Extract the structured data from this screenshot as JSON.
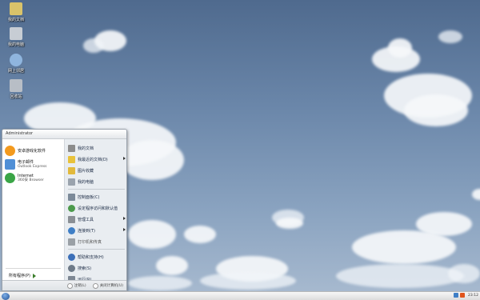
{
  "desktop": {
    "icons": [
      {
        "label": "我的文档",
        "icon": "my-documents-icon",
        "color": "#d9c36a"
      },
      {
        "label": "我的电脑",
        "icon": "my-computer-icon",
        "color": "#c7cdd4"
      },
      {
        "label": "网上邻居",
        "icon": "network-icon",
        "color": "#8fb5de"
      },
      {
        "label": "回收站",
        "icon": "recycle-bin-icon",
        "color": "#b8bec6"
      }
    ]
  },
  "start_menu": {
    "user": "Administrator",
    "pinned": [
      {
        "title": "安卓游戏化软件",
        "subtitle": "",
        "icon": "orange-app-icon",
        "color": "#f39a1e"
      },
      {
        "title": "电子邮件",
        "subtitle": "Outlook Express",
        "icon": "mail-icon",
        "color": "#4f8fd6"
      },
      {
        "title": "Internet",
        "subtitle": "360安 Browser",
        "icon": "browser-icon",
        "color": "#3aa546"
      }
    ],
    "all_programs": "所有程序(P)",
    "right": [
      {
        "label": "我的文档",
        "icon": "documents-icon",
        "color": "#8c8c8c",
        "arrow": false,
        "gray": false
      },
      {
        "label": "我最近的文档(D)",
        "icon": "recent-docs-icon",
        "color": "#e8c23b",
        "arrow": true,
        "gray": false
      },
      {
        "label": "图片收藏",
        "icon": "pictures-icon",
        "color": "#e2b93c",
        "arrow": false,
        "gray": false
      },
      {
        "label": "我的电脑",
        "icon": "computer-icon",
        "color": "#9aa3ad",
        "arrow": false,
        "gray": false
      },
      {
        "label": "控制面板(C)",
        "icon": "control-panel-icon",
        "color": "#7c8a99",
        "arrow": false,
        "gray": false
      },
      {
        "label": "设定程序访问和默认值",
        "icon": "program-access-icon",
        "color": "#4c9a4c",
        "arrow": false,
        "gray": false
      },
      {
        "label": "管理工具",
        "icon": "admin-tools-icon",
        "color": "#8a8f95",
        "arrow": true,
        "gray": false
      },
      {
        "label": "连接到(T)",
        "icon": "connect-icon",
        "color": "#3f7fc6",
        "arrow": true,
        "gray": false
      },
      {
        "label": "打印机和传真",
        "icon": "printer-icon",
        "color": "#9aa0a6",
        "arrow": false,
        "gray": true
      },
      {
        "label": "帮助和支持(H)",
        "icon": "help-icon",
        "color": "#3c6fb8",
        "arrow": false,
        "gray": false
      },
      {
        "label": "搜索(S)",
        "icon": "search-icon",
        "color": "#6e7a88",
        "arrow": false,
        "gray": false
      },
      {
        "label": "运行(R)...",
        "icon": "run-icon",
        "color": "#7d8793",
        "arrow": false,
        "gray": false
      }
    ],
    "footer": {
      "logoff": "注销(L)",
      "shutdown": "关闭计算机(U)"
    }
  },
  "taskbar": {
    "clock": "23:12",
    "tray": [
      {
        "icon": "tray-network-icon",
        "color": "#3f7fc6"
      },
      {
        "icon": "tray-security-icon",
        "color": "#e0541c"
      }
    ]
  }
}
